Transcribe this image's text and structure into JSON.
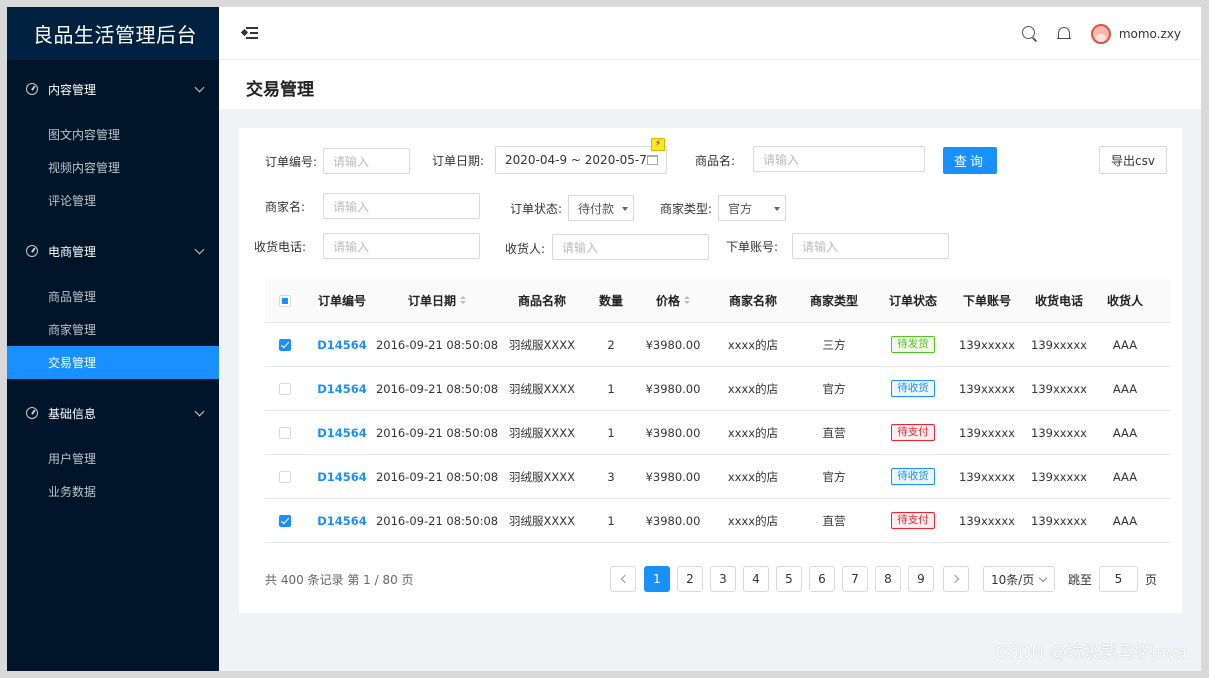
{
  "brand": {
    "title": "良品生活管理后台"
  },
  "sidebar": {
    "groups": [
      {
        "label": "内容管理",
        "items": [
          "图文内容管理",
          "视频内容管理",
          "评论管理"
        ]
      },
      {
        "label": "电商管理",
        "items": [
          "商品管理",
          "商家管理",
          "交易管理"
        ]
      },
      {
        "label": "基础信息",
        "items": [
          "用户管理",
          "业务数据"
        ]
      }
    ],
    "active_item": "交易管理"
  },
  "header": {
    "username": "momo.zxy"
  },
  "page": {
    "title": "交易管理"
  },
  "filters": {
    "order_no_label": "订单编号:",
    "order_no_placeholder": "请输入",
    "order_date_label": "订单日期:",
    "order_date_value": "2020-04-9 ~ 2020-05-7",
    "product_label": "商品名:",
    "product_placeholder": "请输入",
    "query_button": "查询",
    "export_button": "导出csv",
    "merchant_label": "商家名:",
    "merchant_placeholder": "请输入",
    "order_status_label": "订单状态:",
    "order_status_value": "待付款",
    "merchant_type_label": "商家类型:",
    "merchant_type_value": "官方",
    "phone_label": "收货电话:",
    "phone_placeholder": "请输入",
    "receiver_label": "收货人:",
    "receiver_placeholder": "请输入",
    "account_label": "下单账号:",
    "account_placeholder": "请输入"
  },
  "table": {
    "columns": [
      "订单编号",
      "订单日期",
      "商品名称",
      "数量",
      "价格",
      "商家名称",
      "商家类型",
      "订单状态",
      "下单账号",
      "收货电话",
      "收货人"
    ],
    "rows": [
      {
        "checked": true,
        "order_no": "D14564",
        "date": "2016-09-21  08:50:08",
        "product": "羽绒服XXXX",
        "qty": "2",
        "price": "¥3980.00",
        "merchant": "xxxx的店",
        "mtype": "三方",
        "status": "待发货",
        "status_color": "#52c41a",
        "account": "139xxxxx",
        "phone": "139xxxxx",
        "receiver": "AAA"
      },
      {
        "checked": false,
        "order_no": "D14564",
        "date": "2016-09-21  08:50:08",
        "product": "羽绒服XXXX",
        "qty": "1",
        "price": "¥3980.00",
        "merchant": "xxxx的店",
        "mtype": "官方",
        "status": "待收货",
        "status_color": "#1890ff",
        "account": "139xxxxx",
        "phone": "139xxxxx",
        "receiver": "AAA"
      },
      {
        "checked": false,
        "order_no": "D14564",
        "date": "2016-09-21  08:50:08",
        "product": "羽绒服XXXX",
        "qty": "1",
        "price": "¥3980.00",
        "merchant": "xxxx的店",
        "mtype": "直营",
        "status": "待支付",
        "status_color": "#f5222d",
        "account": "139xxxxx",
        "phone": "139xxxxx",
        "receiver": "AAA"
      },
      {
        "checked": false,
        "order_no": "D14564",
        "date": "2016-09-21  08:50:08",
        "product": "羽绒服XXXX",
        "qty": "3",
        "price": "¥3980.00",
        "merchant": "xxxx的店",
        "mtype": "官方",
        "status": "待收货",
        "status_color": "#1890ff",
        "account": "139xxxxx",
        "phone": "139xxxxx",
        "receiver": "AAA"
      },
      {
        "checked": true,
        "order_no": "D14564",
        "date": "2016-09-21  08:50:08",
        "product": "羽绒服XXXX",
        "qty": "1",
        "price": "¥3980.00",
        "merchant": "xxxx的店",
        "mtype": "直营",
        "status": "待支付",
        "status_color": "#f5222d",
        "account": "139xxxxx",
        "phone": "139xxxxx",
        "receiver": "AAA"
      }
    ]
  },
  "pagination": {
    "summary": "共 400 条记录 第 1 / 80 页",
    "pages": [
      "1",
      "2",
      "3",
      "4",
      "5",
      "6",
      "7",
      "8",
      "9"
    ],
    "current": "1",
    "page_size": "10条/页",
    "jump_label": "跳至",
    "jump_value": "5",
    "jump_suffix": "页"
  },
  "watermark": "CSDN @垃圾菜鸟学java",
  "colors": {
    "primary": "#1890ff",
    "sidebar": "#001529",
    "brand_bg": "#002140"
  }
}
